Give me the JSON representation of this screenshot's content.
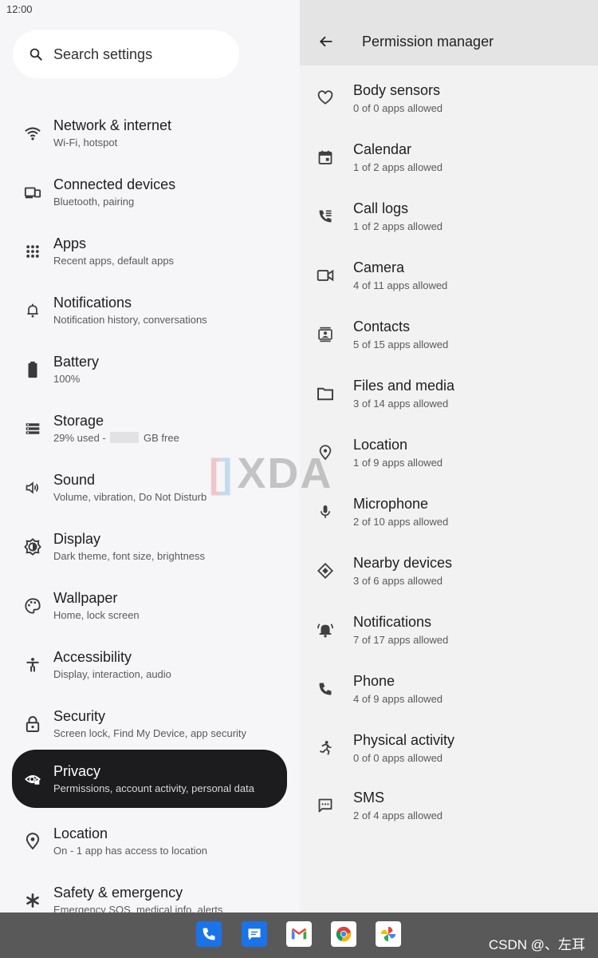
{
  "status_bar": {
    "time": "12:00"
  },
  "settings": {
    "search_placeholder": "Search settings",
    "items": [
      {
        "icon": "wifi-icon",
        "title": "Network & internet",
        "subtitle": "Wi-Fi, hotspot"
      },
      {
        "icon": "devices-icon",
        "title": "Connected devices",
        "subtitle": "Bluetooth, pairing"
      },
      {
        "icon": "apps-grid-icon",
        "title": "Apps",
        "subtitle": "Recent apps, default apps"
      },
      {
        "icon": "bell-icon",
        "title": "Notifications",
        "subtitle": "Notification history, conversations"
      },
      {
        "icon": "battery-icon",
        "title": "Battery",
        "subtitle": "100%"
      },
      {
        "icon": "storage-icon",
        "title": "Storage",
        "subtitle_prefix": "29% used -",
        "subtitle_suffix": "GB free"
      },
      {
        "icon": "speaker-icon",
        "title": "Sound",
        "subtitle": "Volume, vibration, Do Not Disturb"
      },
      {
        "icon": "brightness-icon",
        "title": "Display",
        "subtitle": "Dark theme, font size, brightness"
      },
      {
        "icon": "palette-icon",
        "title": "Wallpaper",
        "subtitle": "Home, lock screen"
      },
      {
        "icon": "accessibility-icon",
        "title": "Accessibility",
        "subtitle": "Display, interaction, audio"
      },
      {
        "icon": "lock-icon",
        "title": "Security",
        "subtitle": "Screen lock, Find My Device, app security"
      },
      {
        "icon": "privacy-eye-icon",
        "title": "Privacy",
        "subtitle": "Permissions, account activity, personal data",
        "active": true
      },
      {
        "icon": "location-pin-icon",
        "title": "Location",
        "subtitle": "On - 1 app has access to location"
      },
      {
        "icon": "asterisk-icon",
        "title": "Safety & emergency",
        "subtitle": "Emergency SOS, medical info, alerts"
      }
    ]
  },
  "permission_manager": {
    "title": "Permission manager",
    "items": [
      {
        "icon": "heart-icon",
        "title": "Body sensors",
        "subtitle": "0 of 0 apps allowed"
      },
      {
        "icon": "calendar-icon",
        "title": "Calendar",
        "subtitle": "1 of 2 apps allowed"
      },
      {
        "icon": "call-log-icon",
        "title": "Call logs",
        "subtitle": "1 of 2 apps allowed"
      },
      {
        "icon": "videocam-icon",
        "title": "Camera",
        "subtitle": "4 of 11 apps allowed"
      },
      {
        "icon": "contacts-icon",
        "title": "Contacts",
        "subtitle": "5 of 15 apps allowed"
      },
      {
        "icon": "folder-icon",
        "title": "Files and media",
        "subtitle": "3 of 14 apps allowed"
      },
      {
        "icon": "location-pin-icon",
        "title": "Location",
        "subtitle": "1 of 9 apps allowed"
      },
      {
        "icon": "microphone-icon",
        "title": "Microphone",
        "subtitle": "2 of 10 apps allowed"
      },
      {
        "icon": "nearby-icon",
        "title": "Nearby devices",
        "subtitle": "3 of 6 apps allowed"
      },
      {
        "icon": "bell-ring-icon",
        "title": "Notifications",
        "subtitle": "7 of 17 apps allowed"
      },
      {
        "icon": "phone-icon",
        "title": "Phone",
        "subtitle": "4 of 9 apps allowed"
      },
      {
        "icon": "run-icon",
        "title": "Physical activity",
        "subtitle": "0 of 0 apps allowed"
      },
      {
        "icon": "sms-icon",
        "title": "SMS",
        "subtitle": "2 of 4 apps allowed"
      }
    ]
  },
  "watermark": {
    "text": "XDA"
  },
  "taskbar": {
    "apps": [
      "phone-app-icon",
      "messages-app-icon",
      "gmail-app-icon",
      "chrome-app-icon",
      "photos-app-icon"
    ]
  },
  "credit": "CSDN @、左耳",
  "colors": {
    "active_bg": "#1c1c1e",
    "taskbar_bg": "#595959",
    "phone_app": "#1a73e8",
    "messages_app": "#1a73e8"
  }
}
